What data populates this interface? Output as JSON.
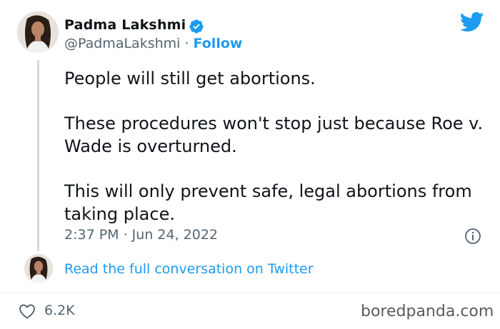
{
  "author": {
    "name": "Padma Lakshmi",
    "handle": "@PadmaLakshmi",
    "separator": " · ",
    "follow_label": "Follow"
  },
  "tweet": {
    "paragraphs": [
      "People will still get abortions.",
      "These procedures won't stop just because Roe v. Wade is overturned.",
      "This will only prevent safe, legal abortions from taking place."
    ],
    "timestamp": "2:37 PM · Jun 24, 2022"
  },
  "read_conversation_label": "Read the full conversation on Twitter",
  "likes": "6.2K",
  "watermark": "boredpanda.com",
  "colors": {
    "accent": "#1d9bf0",
    "secondary_text": "#536471",
    "text": "#0f1419"
  },
  "icons": [
    "verified-badge-icon",
    "twitter-bird-icon",
    "info-icon",
    "heart-icon"
  ]
}
